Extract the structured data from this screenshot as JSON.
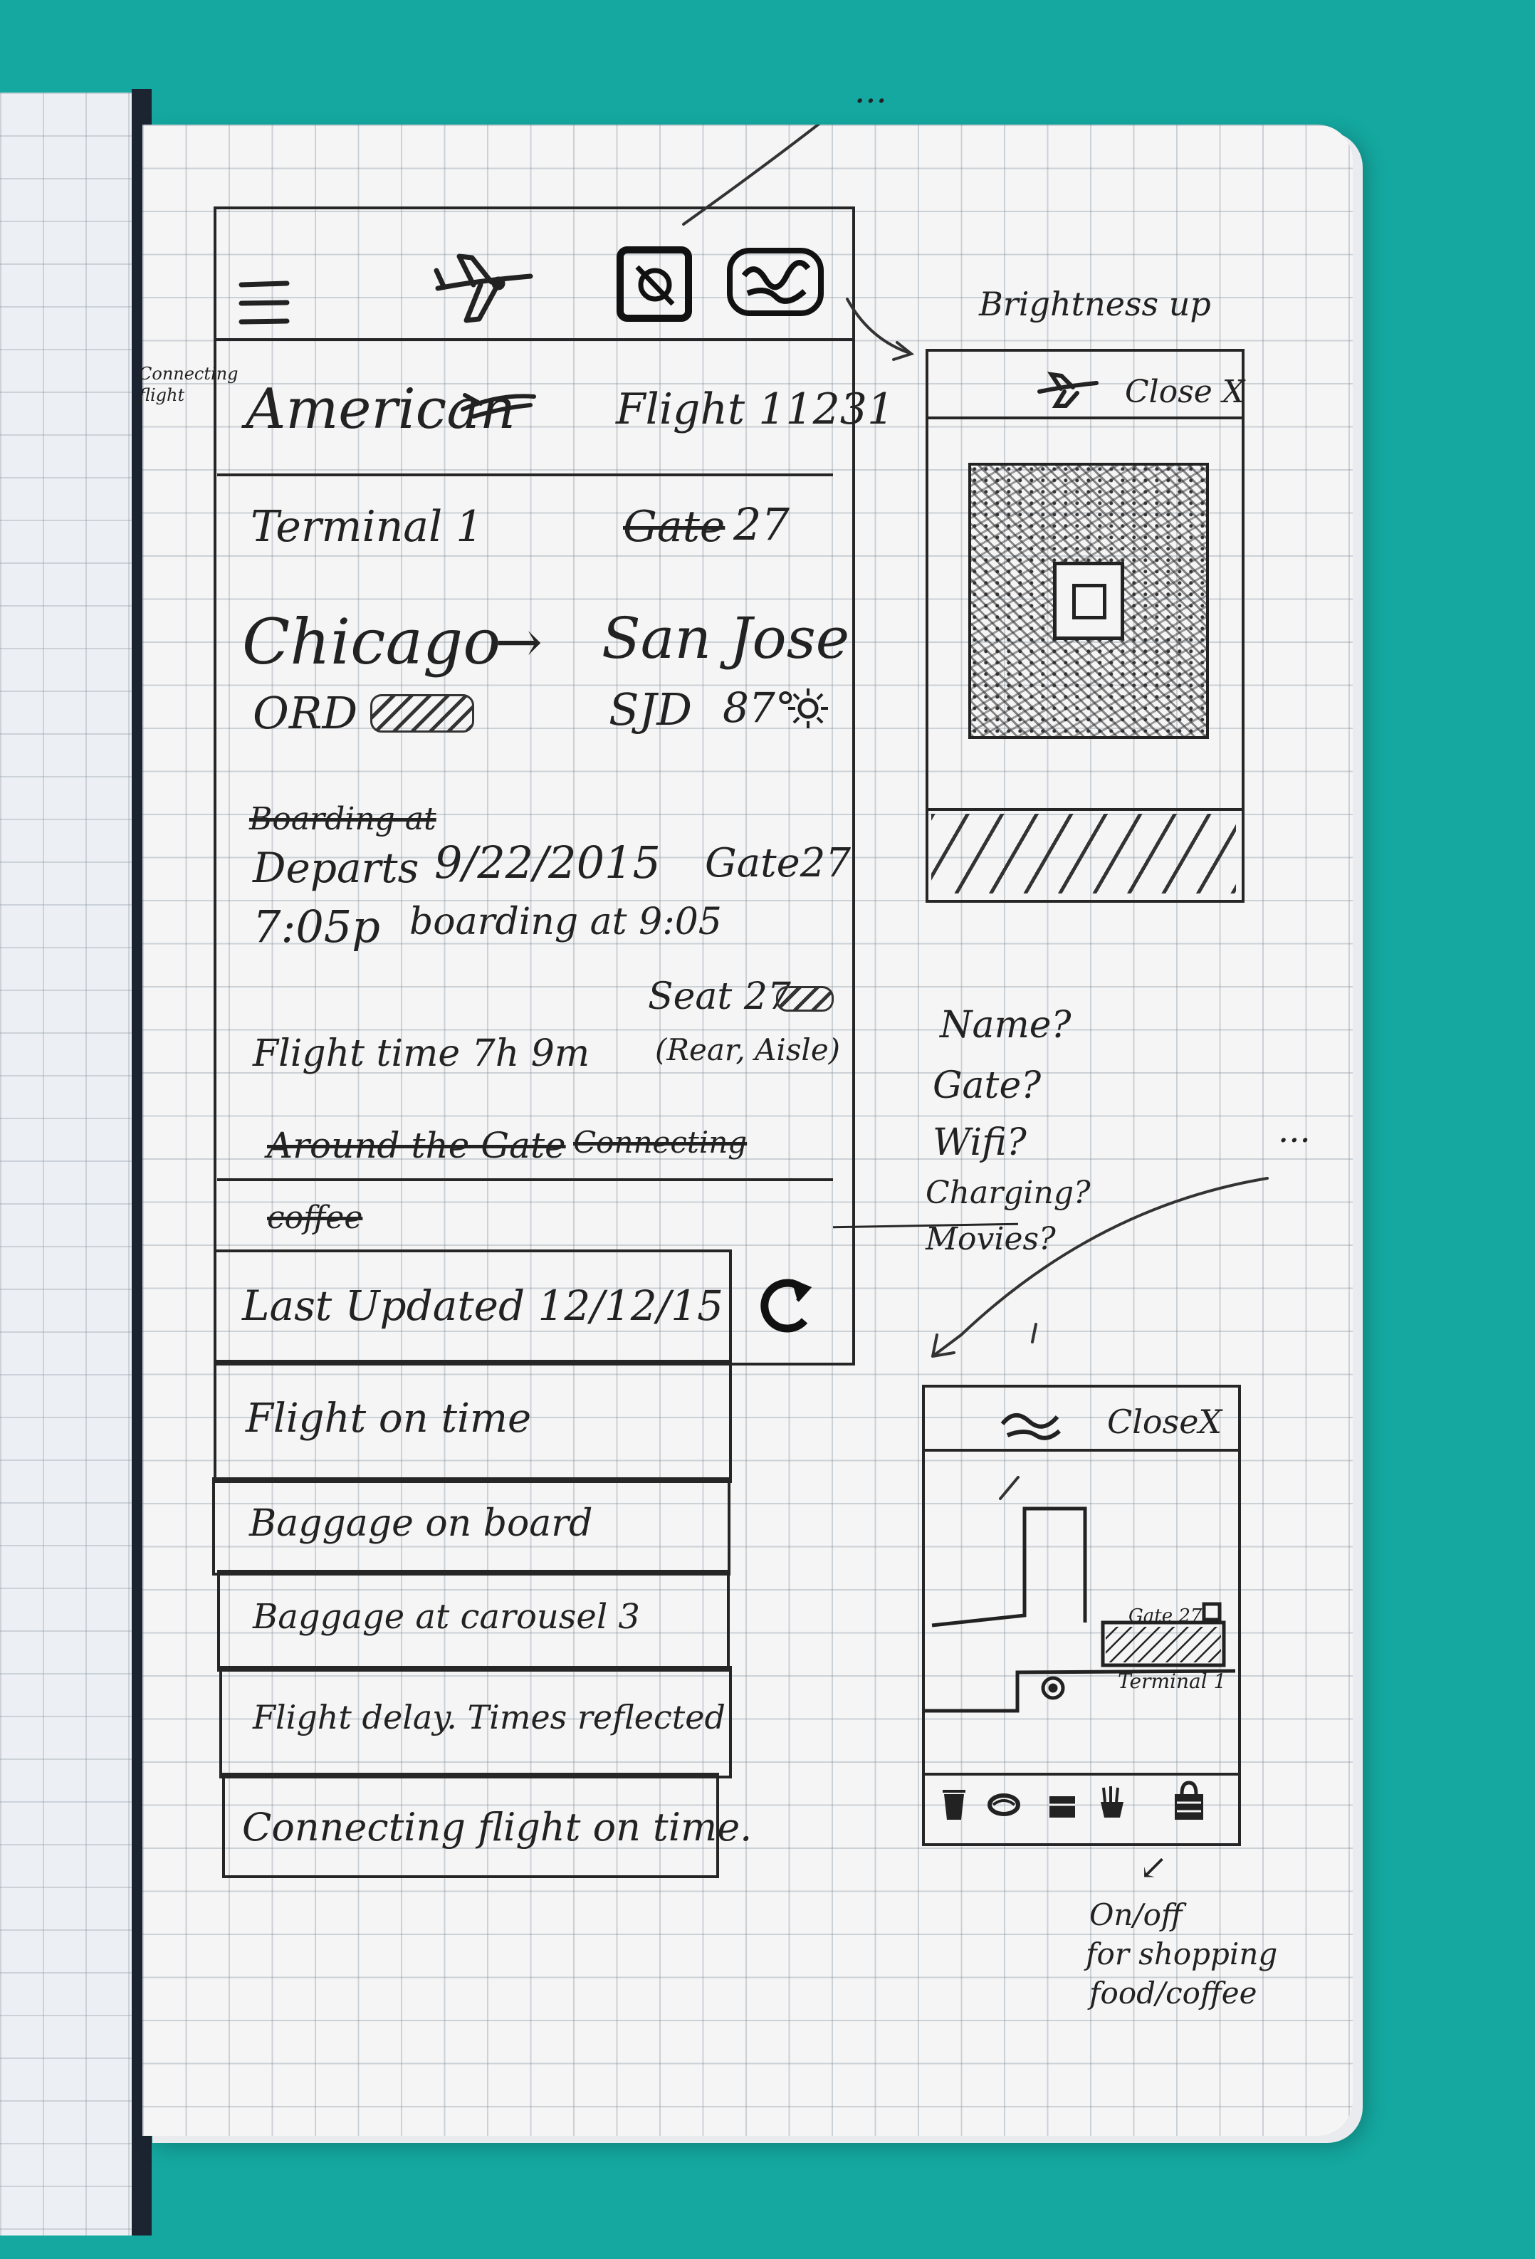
{
  "main_screen": {
    "airline": "American",
    "flight": "Flight 11231",
    "terminal": "Terminal 1",
    "gate_struck": "Gate",
    "gate_number": "27",
    "origin_city": "Chicago",
    "arrow": "→",
    "destination_city": "San Jose",
    "origin_code": "ORD",
    "destination_code": "SJD",
    "destination_temp": "87°",
    "boarding_struck": "Boarding at",
    "departs_label": "Departs",
    "departs_date": "9/22/2015",
    "departs_gate": "Gate27",
    "departs_time": "7:05p",
    "boarding_at": "boarding at 9:05",
    "seat": "Seat 27",
    "seat_detail": "(Rear, Aisle)",
    "flight_time": "Flight time 7h 9m",
    "struck_around": "Around the Gate",
    "struck_connecting": "Connecting",
    "struck_coffee": "coffee",
    "last_updated": "Last Updated 12/12/15",
    "notifications": [
      "Flight on time",
      "Baggage on board",
      "Baggage at carousel 3",
      "Flight delay. Times reflected",
      "Connecting flight on time."
    ]
  },
  "side_note_left": "Connecting flight",
  "boarding_pass": {
    "annotation": "Brightness up",
    "close_label": "Close X"
  },
  "questions": [
    "Name?",
    "Gate?",
    "Wifi?",
    "Charging?",
    "Movies?"
  ],
  "map_screen": {
    "close_label": "CloseX",
    "gate_label": "Gate 27",
    "terminal_label": "Terminal 1",
    "filter_icons": [
      "coffee-icon",
      "food-icon",
      "shop-icon",
      "fries-icon",
      "bag-icon"
    ],
    "annotation_arrow": "↙",
    "annotation_lines": [
      "On/off",
      "for shopping",
      "food/coffee"
    ]
  },
  "ellipsis": "..."
}
